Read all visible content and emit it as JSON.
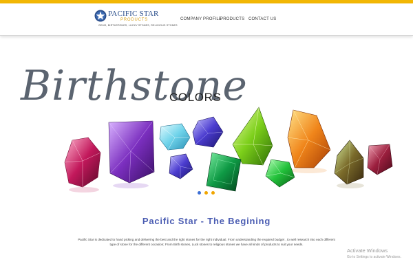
{
  "brand": {
    "name": "PACIFIC STAR",
    "subname": "PRODUCTS",
    "tagline": "GEMS, BIRTHSTONES, LUCKY STONES, RELIGIOUS STONES",
    "logo_icon": "star-globe-icon"
  },
  "nav": {
    "items": [
      {
        "label": "COMPANY PROFILE"
      },
      {
        "label": "PRODUCTS"
      },
      {
        "label": "CONTACT US"
      }
    ]
  },
  "hero": {
    "script_text": "Birthstone",
    "caps_text": "COLORS",
    "slides": 3,
    "active_slide": 1
  },
  "section": {
    "title": "Pacific Star - The Begining",
    "body": "Pacific Star is dedicated to hand picking and delivering the best and the right stones for the right individual. From understanding the required budget , to well research into each different type of stone for the different occasion; From Birth stones, Luck stones to religious stones we have all kinds of products to suit your needs."
  },
  "watermark": {
    "title": "Activate Windows",
    "subtitle": "Go to Settings to activate Windows."
  },
  "colors": {
    "accent_bar": "#f2b705",
    "brand_blue": "#2b4f8c",
    "title_blue": "#4a5cb2",
    "dot_active": "#3d6fd6",
    "dot_inactive": "#f0a500"
  }
}
